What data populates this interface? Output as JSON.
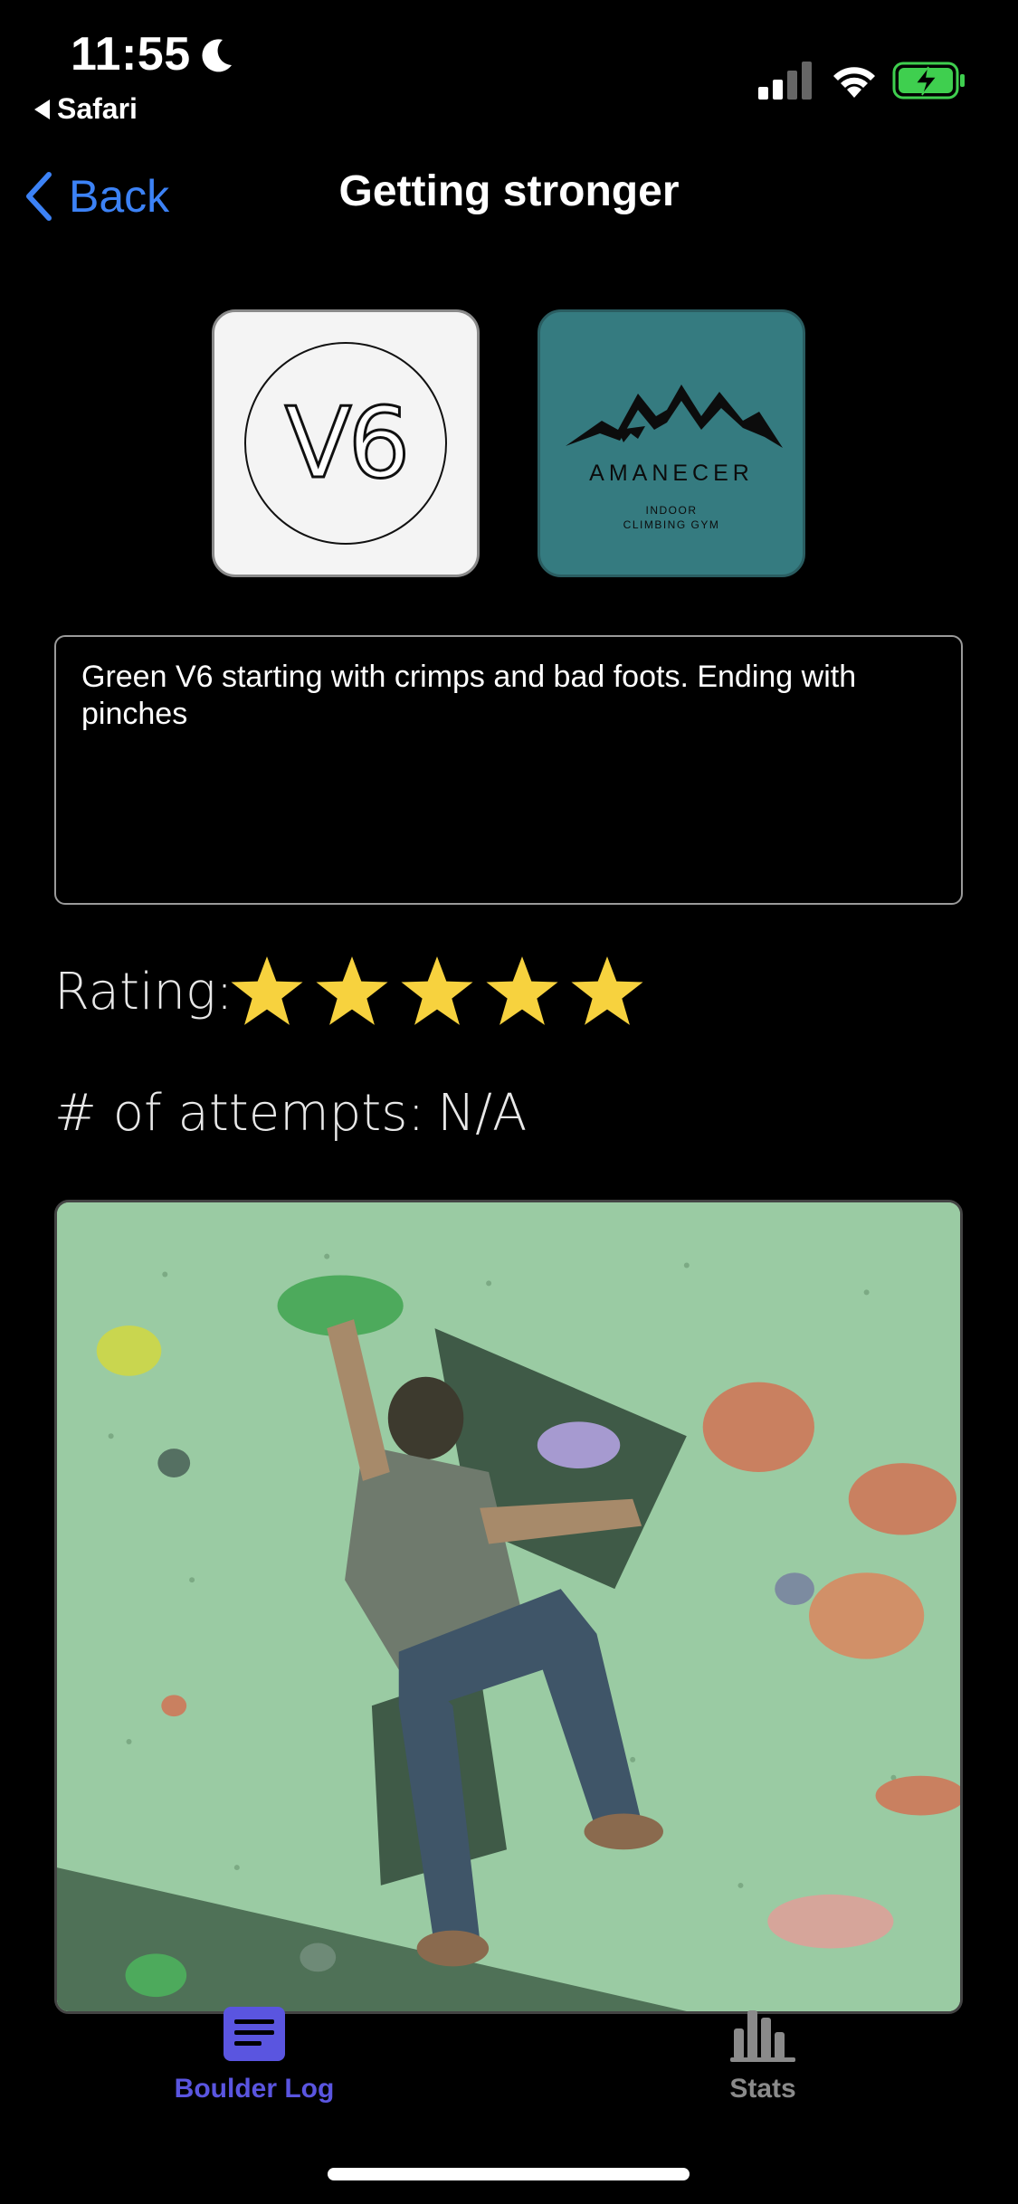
{
  "status_bar": {
    "time": "11:55",
    "back_app": "Safari",
    "icons": [
      "moon-icon",
      "cellular-signal-icon",
      "wifi-icon",
      "battery-charging-icon"
    ]
  },
  "nav": {
    "back_label": "Back",
    "title": "Getting stronger"
  },
  "tiles": {
    "grade_label": "V6",
    "gym_name": "AMANECER",
    "gym_sub_line1": "INDOOR",
    "gym_sub_line2": "CLIMBING GYM",
    "gym_bg_color": "#357b80"
  },
  "description": "Green V6 starting with crimps and bad foots. Ending with pinches",
  "rating": {
    "label": "Rating:",
    "stars": 5,
    "max": 5,
    "star_color": "#f7d23e"
  },
  "attempts": {
    "label": "# of attempts:",
    "value": "N/A"
  },
  "tab_bar": {
    "items": [
      {
        "label": "Boulder Log",
        "icon": "document-lines-icon",
        "active": true,
        "color": "#5a55e0"
      },
      {
        "label": "Stats",
        "icon": "bar-chart-icon",
        "active": false,
        "color": "#8a8a8a"
      }
    ]
  }
}
